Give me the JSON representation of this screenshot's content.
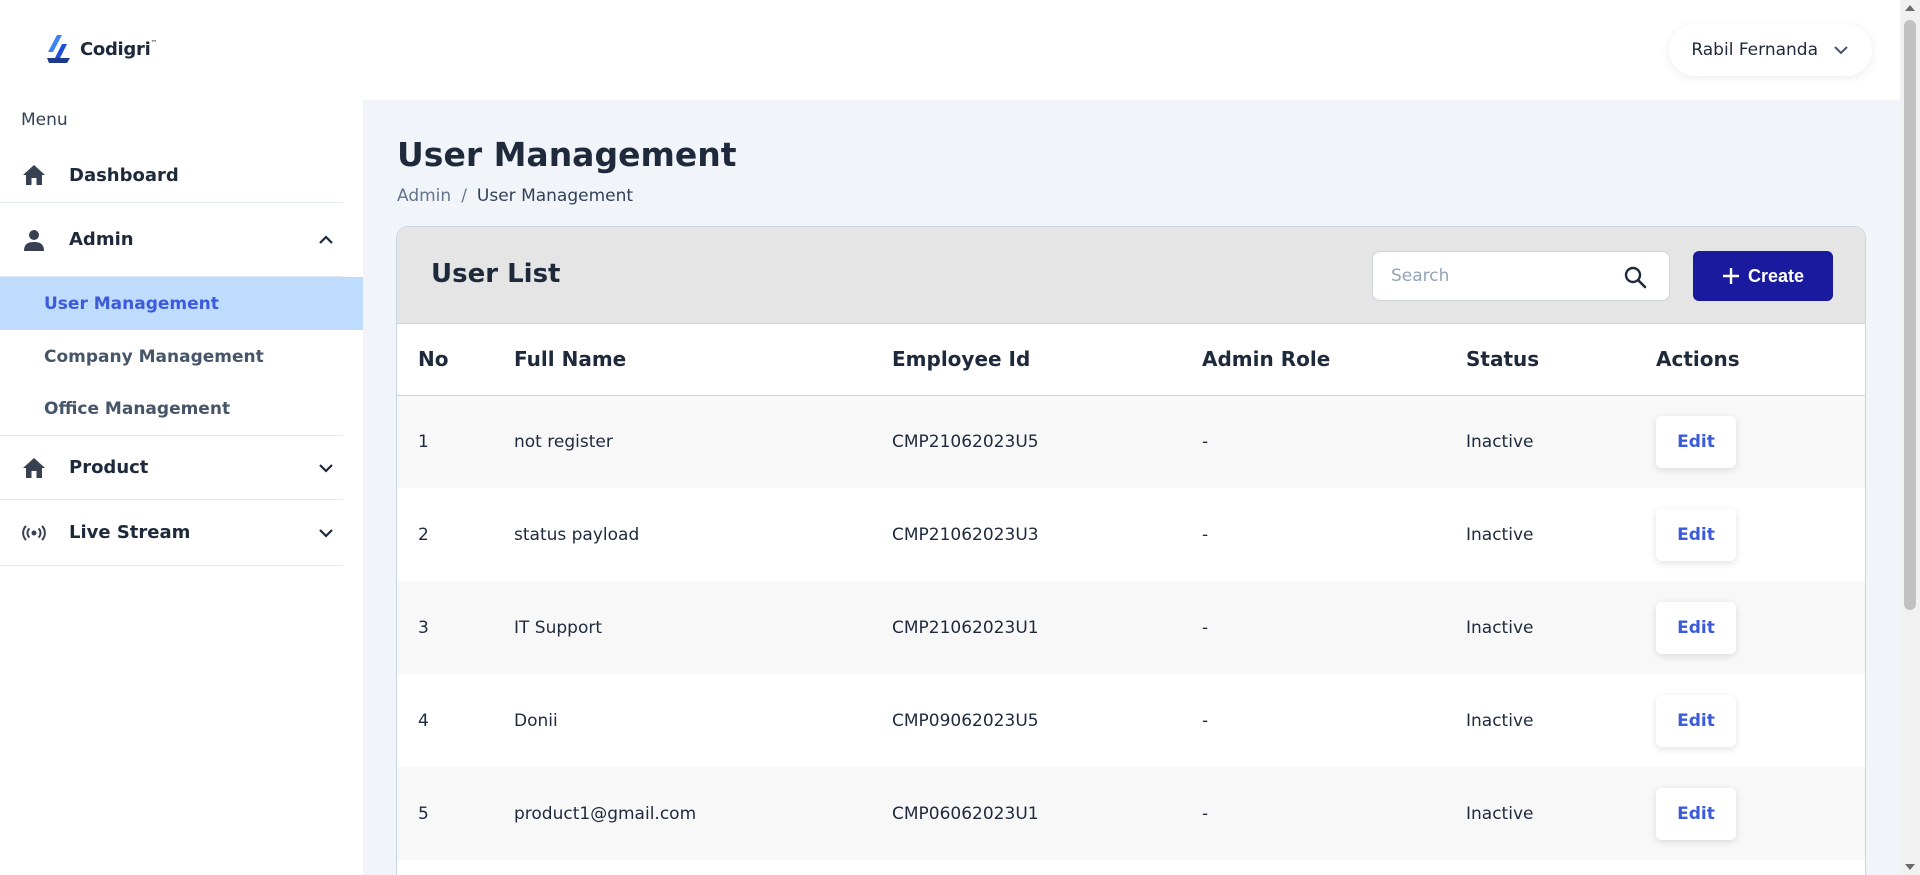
{
  "brand": {
    "name": "Codigri",
    "tm": "™",
    "accent": "#1a1a9e"
  },
  "sidebar": {
    "menu_label": "Menu",
    "items": [
      {
        "label": "Dashboard",
        "icon": "home-icon"
      },
      {
        "label": "Admin",
        "icon": "user-icon",
        "expanded": true,
        "children": [
          {
            "label": "User Management",
            "active": true
          },
          {
            "label": "Company Management"
          },
          {
            "label": "Office Management"
          }
        ]
      },
      {
        "label": "Product",
        "icon": "home-icon",
        "expanded": false
      },
      {
        "label": "Live Stream",
        "icon": "broadcast-icon",
        "expanded": false
      }
    ]
  },
  "header": {
    "user_name": "Rabil Fernanda"
  },
  "page": {
    "title": "User Management",
    "breadcrumb": [
      "Admin",
      "/",
      "User Management"
    ]
  },
  "card": {
    "title": "User List",
    "search_placeholder": "Search",
    "create_label": "Create"
  },
  "table": {
    "columns": [
      "No",
      "Full Name",
      "Employee Id",
      "Admin Role",
      "Status",
      "Actions"
    ],
    "action_label": "Edit",
    "rows": [
      {
        "no": "1",
        "name": "not register",
        "emp": "CMP21062023U5",
        "role": "-",
        "status": "Inactive"
      },
      {
        "no": "2",
        "name": "status payload",
        "emp": "CMP21062023U3",
        "role": "-",
        "status": "Inactive"
      },
      {
        "no": "3",
        "name": "IT Support",
        "emp": "CMP21062023U1",
        "role": "-",
        "status": "Inactive"
      },
      {
        "no": "4",
        "name": "Donii",
        "emp": "CMP09062023U5",
        "role": "-",
        "status": "Inactive"
      },
      {
        "no": "5",
        "name": "product1@gmail.com",
        "emp": "CMP06062023U1",
        "role": "-",
        "status": "Inactive"
      }
    ]
  }
}
